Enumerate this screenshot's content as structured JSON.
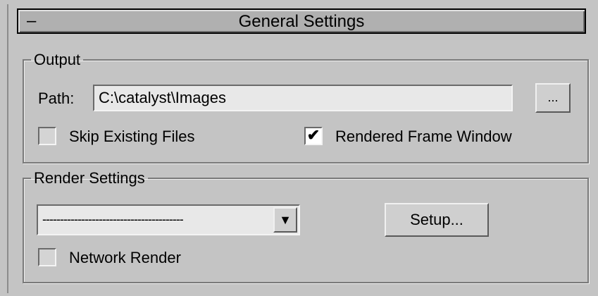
{
  "rollout": {
    "collapse_symbol": "–",
    "title": "General Settings"
  },
  "output": {
    "group_label": "Output",
    "path_label": "Path:",
    "path_value": "C:\\catalyst\\Images",
    "browse_label": "...",
    "skip_existing": {
      "label": "Skip Existing Files",
      "checked": false
    },
    "rendered_frame_window": {
      "label": "Rendered Frame Window",
      "checked": true
    }
  },
  "render_settings": {
    "group_label": "Render Settings",
    "preset_selected": "----------------------------------------",
    "dropdown_arrow": "▼",
    "setup_label": "Setup...",
    "network_render": {
      "label": "Network Render",
      "checked": false
    }
  },
  "checkmark": "✔"
}
